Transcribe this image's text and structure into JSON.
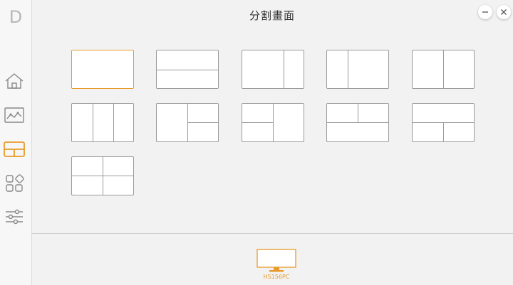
{
  "app": {
    "logo_letter": "D"
  },
  "header": {
    "title": "分割畫面"
  },
  "window_controls": {
    "minimize": "minimize-icon",
    "close": "close-icon"
  },
  "sidebar": {
    "items": [
      {
        "icon": "home-icon"
      },
      {
        "icon": "picture-icon"
      },
      {
        "icon": "split-screen-icon",
        "active": true
      },
      {
        "icon": "apps-icon"
      },
      {
        "icon": "sliders-icon"
      }
    ]
  },
  "layouts": [
    {
      "name": "single",
      "selected": true
    },
    {
      "name": "two-horizontal"
    },
    {
      "name": "two-vertical-left-wide"
    },
    {
      "name": "two-vertical-right-wide"
    },
    {
      "name": "two-vertical-equal"
    },
    {
      "name": "three-columns"
    },
    {
      "name": "left-big-right-two"
    },
    {
      "name": "right-big-left-two"
    },
    {
      "name": "top-two-bottom-one"
    },
    {
      "name": "top-one-bottom-two"
    },
    {
      "name": "four-grid"
    }
  ],
  "monitor": {
    "label": "HS156PC"
  },
  "colors": {
    "accent": "#e89a2a",
    "border": "#9a9a9a",
    "icon": "#888888"
  }
}
